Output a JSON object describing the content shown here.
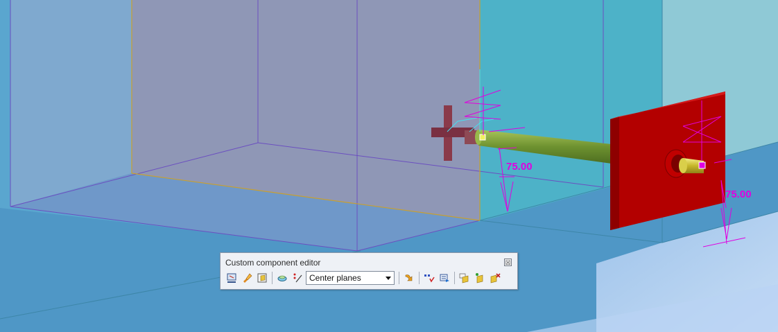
{
  "viewport": {
    "dimensions": {
      "left": "75.00",
      "right": "75.00"
    }
  },
  "toolbar": {
    "title": "Custom component editor",
    "close_glyph": "☒",
    "planes_select": {
      "value": "Center planes"
    },
    "buttons": [
      {
        "name": "define-input-objects-icon"
      },
      {
        "name": "edit-component-icon"
      },
      {
        "name": "save-component-icon"
      },
      {
        "name": "show-planes-icon"
      },
      {
        "name": "add-distance-icon"
      },
      {
        "name": "apply-planes-icon"
      },
      {
        "name": "add-points-icon"
      },
      {
        "name": "variables-icon"
      },
      {
        "name": "save-as-icon"
      },
      {
        "name": "refresh-component-icon"
      },
      {
        "name": "close-editor-icon"
      }
    ]
  },
  "colors": {
    "magenta_dim": "#e000e0",
    "red_plate": "#b00000",
    "rod_green": "#7ea23a",
    "toolbar_bg": "#eef1f6"
  }
}
